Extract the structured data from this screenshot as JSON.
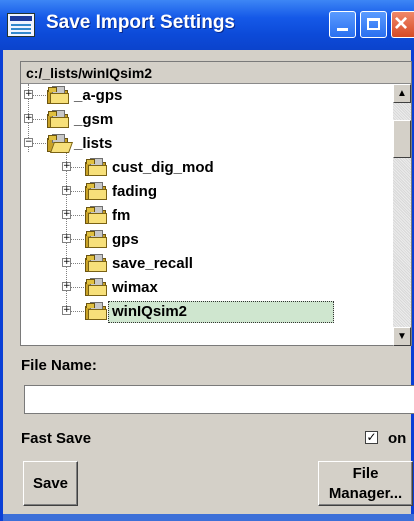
{
  "window": {
    "title": "Save Import Settings",
    "title_bar_color": "#0c4ad8",
    "buttons": [
      "minimize",
      "maximize",
      "close"
    ]
  },
  "browser": {
    "path": "c:/_lists/winIQsim2",
    "tree": [
      {
        "label": "_a-gps",
        "level": 0,
        "expanded": false,
        "icon": "folder-icon"
      },
      {
        "label": "_gsm",
        "level": 0,
        "expanded": false,
        "icon": "folder-icon"
      },
      {
        "label": "_lists",
        "level": 0,
        "expanded": true,
        "icon": "open-folder-icon"
      },
      {
        "label": "cust_dig_mod",
        "level": 1,
        "expanded": false,
        "icon": "folder-icon"
      },
      {
        "label": "fading",
        "level": 1,
        "expanded": false,
        "icon": "folder-icon"
      },
      {
        "label": "fm",
        "level": 1,
        "expanded": false,
        "icon": "folder-icon"
      },
      {
        "label": "gps",
        "level": 1,
        "expanded": false,
        "icon": "folder-icon"
      },
      {
        "label": "save_recall",
        "level": 1,
        "expanded": false,
        "icon": "folder-icon"
      },
      {
        "label": "wimax",
        "level": 1,
        "expanded": false,
        "icon": "folder-icon"
      },
      {
        "label": "winIQsim2",
        "level": 1,
        "expanded": false,
        "icon": "folder-icon",
        "selected": true
      }
    ]
  },
  "file_name": {
    "label": "File Name:",
    "value": "",
    "placeholder": ""
  },
  "fast_save": {
    "label": "Fast Save",
    "checked": true,
    "checkbox_label": "on"
  },
  "actions": {
    "save_label": "Save",
    "file_manager_line1": "File",
    "file_manager_line2": "Manager..."
  },
  "colors": {
    "selection_bg": "#cfe6cf",
    "dialog_bg": "#d4d0c8",
    "folder": "#f7e07a"
  }
}
